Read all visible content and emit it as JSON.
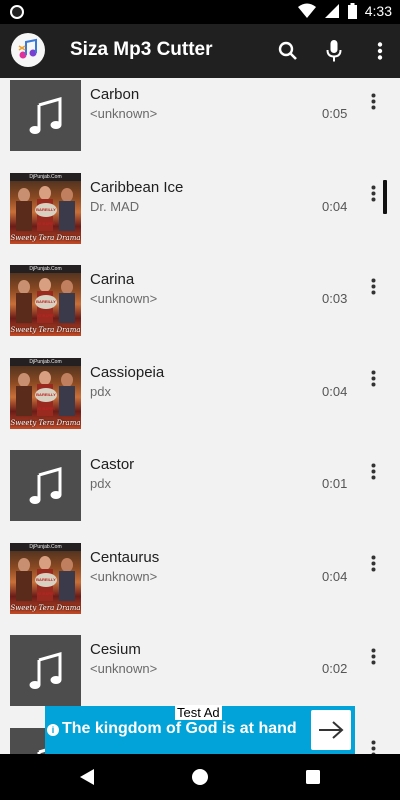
{
  "status_bar": {
    "time": "4:33"
  },
  "app_bar": {
    "title": "Siza Mp3 Cutter"
  },
  "songs": [
    {
      "title": "Carbon",
      "artist": "<unknown>",
      "duration": "0:05",
      "thumb": "music-note"
    },
    {
      "title": "Caribbean Ice",
      "artist": "Dr. MAD",
      "duration": "0:04",
      "thumb": "album-art"
    },
    {
      "title": "Carina",
      "artist": "<unknown>",
      "duration": "0:03",
      "thumb": "album-art"
    },
    {
      "title": "Cassiopeia",
      "artist": "pdx",
      "duration": "0:04",
      "thumb": "album-art"
    },
    {
      "title": "Castor",
      "artist": "pdx",
      "duration": "0:01",
      "thumb": "music-note"
    },
    {
      "title": "Centaurus",
      "artist": "<unknown>",
      "duration": "0:04",
      "thumb": "album-art"
    },
    {
      "title": "Cesium",
      "artist": "<unknown>",
      "duration": "0:02",
      "thumb": "music-note"
    },
    {
      "title": "",
      "artist": "",
      "duration": "",
      "thumb": "music-note"
    }
  ],
  "album_art": {
    "poster_text": "Sweety Tera Drama",
    "top_text": "DjPunjab.Com",
    "badge_text": "BAREILLY KI BARFI"
  },
  "ad": {
    "label": "Test Ad",
    "text": "The kingdom of God is at hand"
  },
  "colors": {
    "app_bar": "#202020",
    "ad_bg": "#02a3d8",
    "background": "#f2f2f2"
  }
}
